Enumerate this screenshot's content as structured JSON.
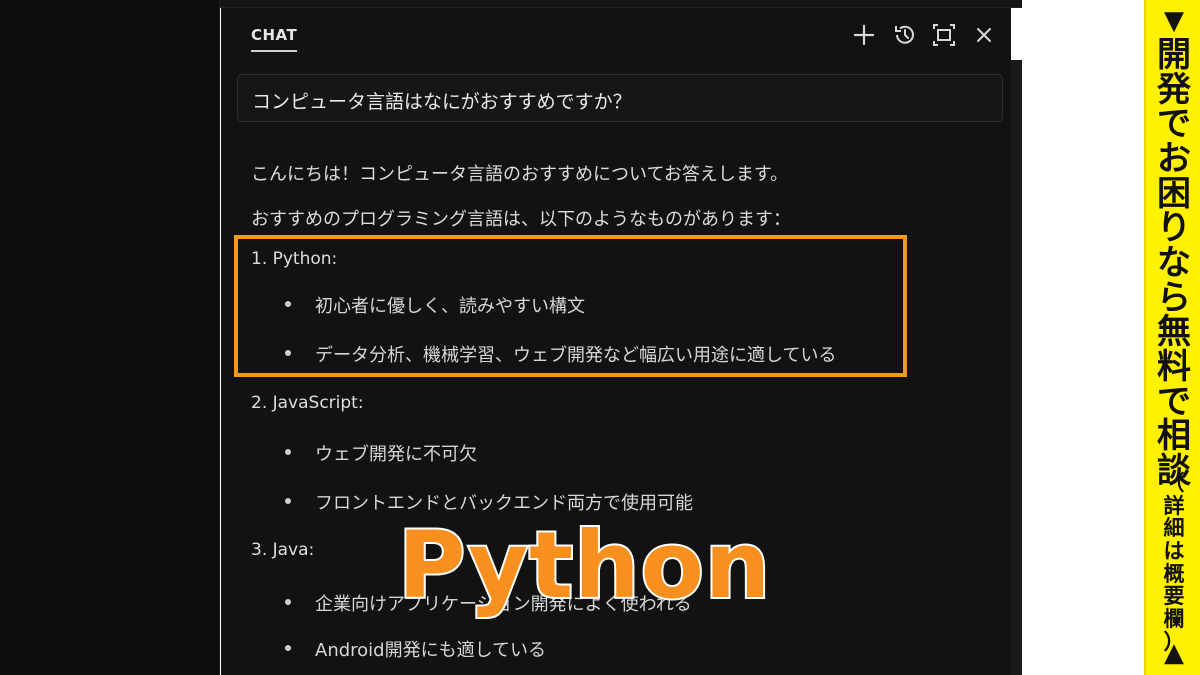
{
  "chat": {
    "tab_label": "CHAT",
    "icons": [
      "plus-icon",
      "history-icon",
      "expand-icon",
      "close-icon"
    ],
    "query": "コンピュータ言語はなにがおすすめですか？",
    "intro": "こんにちは！コンピュータ言語のおすすめについてお答えします。",
    "lead": "おすすめのプログラミング言語は、以下のようなものがあります：",
    "languages": [
      {
        "heading": "1. Python:",
        "bullets": [
          "初心者に優しく、読みやすい構文",
          "データ分析、機械学習、ウェブ開発など幅広い用途に適している"
        ]
      },
      {
        "heading": "2. JavaScript:",
        "bullets": [
          "ウェブ開発に不可欠",
          "フロントエンドとバックエンド両方で使用可能"
        ]
      },
      {
        "heading": "3. Java:",
        "bullets": [
          "企業向けアプリケーション開発によく使われる",
          "Android開発にも適している"
        ]
      }
    ]
  },
  "caption": {
    "text": "Python"
  },
  "banner": {
    "arrow_top": "▼",
    "main": [
      "開",
      "発",
      "で",
      "お",
      "困",
      "り",
      "な",
      "ら",
      "無",
      "料",
      "で",
      "相",
      "談"
    ],
    "small": [
      "（",
      "詳",
      "細",
      "は",
      "概",
      "要",
      "欄",
      "）"
    ],
    "arrow_bottom": "▲"
  },
  "colors": {
    "highlight": "#f39a1e",
    "caption": "#f7901e",
    "banner": "#fff100",
    "panel": "#121212"
  }
}
